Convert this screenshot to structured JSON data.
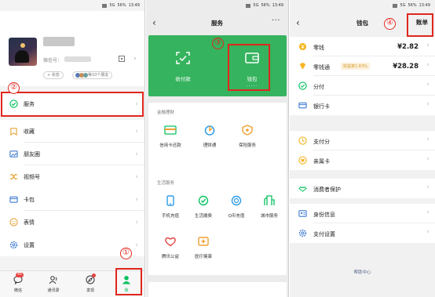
{
  "markers": [
    "①",
    "②",
    "③",
    "④"
  ],
  "status": {
    "time": "13:49",
    "network": "5G",
    "battery": "56%"
  },
  "me_page": {
    "wechat_id_label": "微信号：",
    "status_button": "+ 状态",
    "friends_status": "等10个朋友",
    "menu": [
      {
        "label": "服务",
        "icon": "service-icon"
      },
      {
        "label": "收藏",
        "icon": "favorites-icon"
      },
      {
        "label": "朋友圈",
        "icon": "moments-icon"
      },
      {
        "label": "视频号",
        "icon": "channels-icon"
      },
      {
        "label": "卡包",
        "icon": "card-wallet-icon"
      },
      {
        "label": "表情",
        "icon": "sticker-icon"
      },
      {
        "label": "设置",
        "icon": "settings-icon"
      }
    ],
    "tabs": [
      {
        "label": "微信",
        "icon": "chat-icon",
        "badge": "46"
      },
      {
        "label": "通讯录",
        "icon": "contacts-icon"
      },
      {
        "label": "发现",
        "icon": "discover-icon"
      },
      {
        "label": "我",
        "icon": "me-icon"
      }
    ]
  },
  "services_page": {
    "title": "服务",
    "more": "···",
    "pay": {
      "label": "收付款",
      "icon": "scan-pay-icon"
    },
    "wallet": {
      "label": "钱包",
      "value": "·····",
      "icon": "wallet-icon"
    },
    "finance_title": "金融理财",
    "finance": [
      {
        "label": "信用卡还款",
        "icon": "credit-card-icon"
      },
      {
        "label": "理财通",
        "icon": "wealth-icon"
      },
      {
        "label": "保险服务",
        "icon": "insurance-icon"
      }
    ],
    "life_title": "生活服务",
    "life": [
      {
        "label": "手机充值",
        "icon": "phone-topup-icon"
      },
      {
        "label": "生活缴费",
        "icon": "utility-payment-icon"
      },
      {
        "label": "Q币充值",
        "icon": "qcoin-icon"
      },
      {
        "label": "城市服务",
        "icon": "city-service-icon"
      },
      {
        "label": "腾讯公益",
        "icon": "charity-icon"
      },
      {
        "label": "医疗健康",
        "icon": "healthcare-icon"
      }
    ]
  },
  "wallet_page": {
    "title": "钱包",
    "bill_button": "账单",
    "rows": [
      {
        "label": "零钱",
        "value": "¥2.82",
        "icon": "change-icon"
      },
      {
        "label": "零钱通",
        "tag": "收益率1.83%",
        "value": "¥28.28",
        "icon": "change-plus-icon"
      },
      {
        "label": "分付",
        "icon": "fenfu-icon"
      },
      {
        "label": "银行卡",
        "icon": "bank-card-icon"
      },
      {
        "label": "支付分",
        "icon": "pay-score-icon"
      },
      {
        "label": "亲属卡",
        "icon": "family-card-icon"
      },
      {
        "label": "消费者保护",
        "icon": "consumer-protect-icon"
      },
      {
        "label": "身份信息",
        "icon": "identity-icon"
      },
      {
        "label": "支付设置",
        "icon": "pay-settings-icon"
      }
    ],
    "help": "帮助中心"
  },
  "colors": {
    "brand_green": "#07c160",
    "card_green": "#35b35e",
    "annotation_red": "#e0261d"
  }
}
